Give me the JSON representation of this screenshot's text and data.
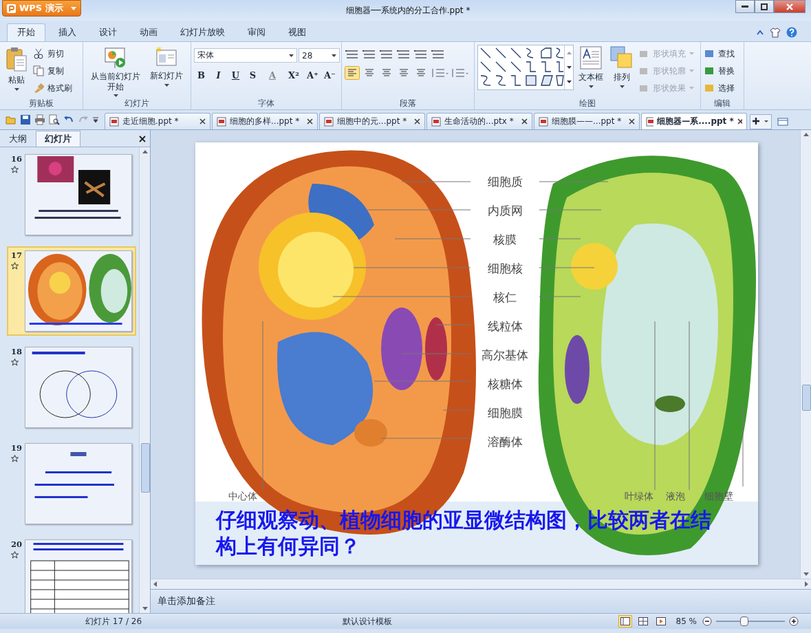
{
  "window": {
    "app_button": "WPS 演示",
    "title": "细胞器──系统内的分工合作.ppt *"
  },
  "menu_tabs": [
    {
      "label": "开始",
      "selected": true
    },
    {
      "label": "插入",
      "selected": false
    },
    {
      "label": "设计",
      "selected": false
    },
    {
      "label": "动画",
      "selected": false
    },
    {
      "label": "幻灯片放映",
      "selected": false
    },
    {
      "label": "审阅",
      "selected": false
    },
    {
      "label": "视图",
      "selected": false
    }
  ],
  "clipboard": {
    "label": "剪贴板",
    "paste": "粘贴",
    "items": [
      "剪切",
      "复制",
      "格式刷"
    ]
  },
  "slides_group": {
    "label": "幻灯片",
    "start": "从当前幻灯片开始",
    "new_slide": "新幻灯片"
  },
  "font": {
    "label": "字体",
    "family": "宋体",
    "size": "28",
    "buttons": [
      "B",
      "I",
      "U",
      "S",
      "A",
      "X²",
      "A⁺",
      "A⁻"
    ]
  },
  "paragraph": {
    "label": "段落"
  },
  "drawing": {
    "label": "绘图",
    "textbox": "文本框",
    "arrange": "排列",
    "shape_options": [
      {
        "label": "形状填充",
        "disabled": true
      },
      {
        "label": "形状轮廓",
        "disabled": true
      },
      {
        "label": "形状效果",
        "disabled": true
      }
    ]
  },
  "editing": {
    "label": "编辑",
    "items": [
      "查找",
      "替换",
      "选择"
    ]
  },
  "doc_tabs": [
    {
      "label": "走近细胞.ppt *",
      "selected": false
    },
    {
      "label": "细胞的多样...ppt *",
      "selected": false
    },
    {
      "label": "细胞中的元...ppt *",
      "selected": false
    },
    {
      "label": "生命活动的...ptx *",
      "selected": false
    },
    {
      "label": "细胞膜——...ppt *",
      "selected": false
    },
    {
      "label": "细胞器—系....ppt *",
      "selected": true
    }
  ],
  "side_pane": {
    "tabs": [
      {
        "label": "大纲",
        "selected": false
      },
      {
        "label": "幻灯片",
        "selected": true
      }
    ],
    "slides": [
      {
        "number": "16",
        "selected": false
      },
      {
        "number": "17",
        "selected": true
      },
      {
        "number": "18",
        "selected": false
      },
      {
        "number": "19",
        "selected": false
      },
      {
        "number": "20",
        "selected": false
      }
    ]
  },
  "slide": {
    "labels": [
      "细胞质",
      "内质网",
      "核膜",
      "细胞核",
      "核仁",
      "线粒体",
      "高尔基体",
      "核糖体",
      "细胞膜",
      "溶酶体"
    ],
    "bottom_labels": [
      "中心体",
      "叶绿体",
      "液泡",
      "细胞壁"
    ],
    "caption": "仔细观察动、植物细胞的亚显微结构图，比较两者在结构上有何异同？"
  },
  "notes": {
    "placeholder": "单击添加备注"
  },
  "status_bar": {
    "slide_count": "幻灯片 17 / 26",
    "template": "默认设计模板",
    "views": [
      {
        "selected": true
      },
      {
        "selected": false
      },
      {
        "selected": false
      }
    ],
    "zoom": "85 %",
    "level": 0.4
  }
}
